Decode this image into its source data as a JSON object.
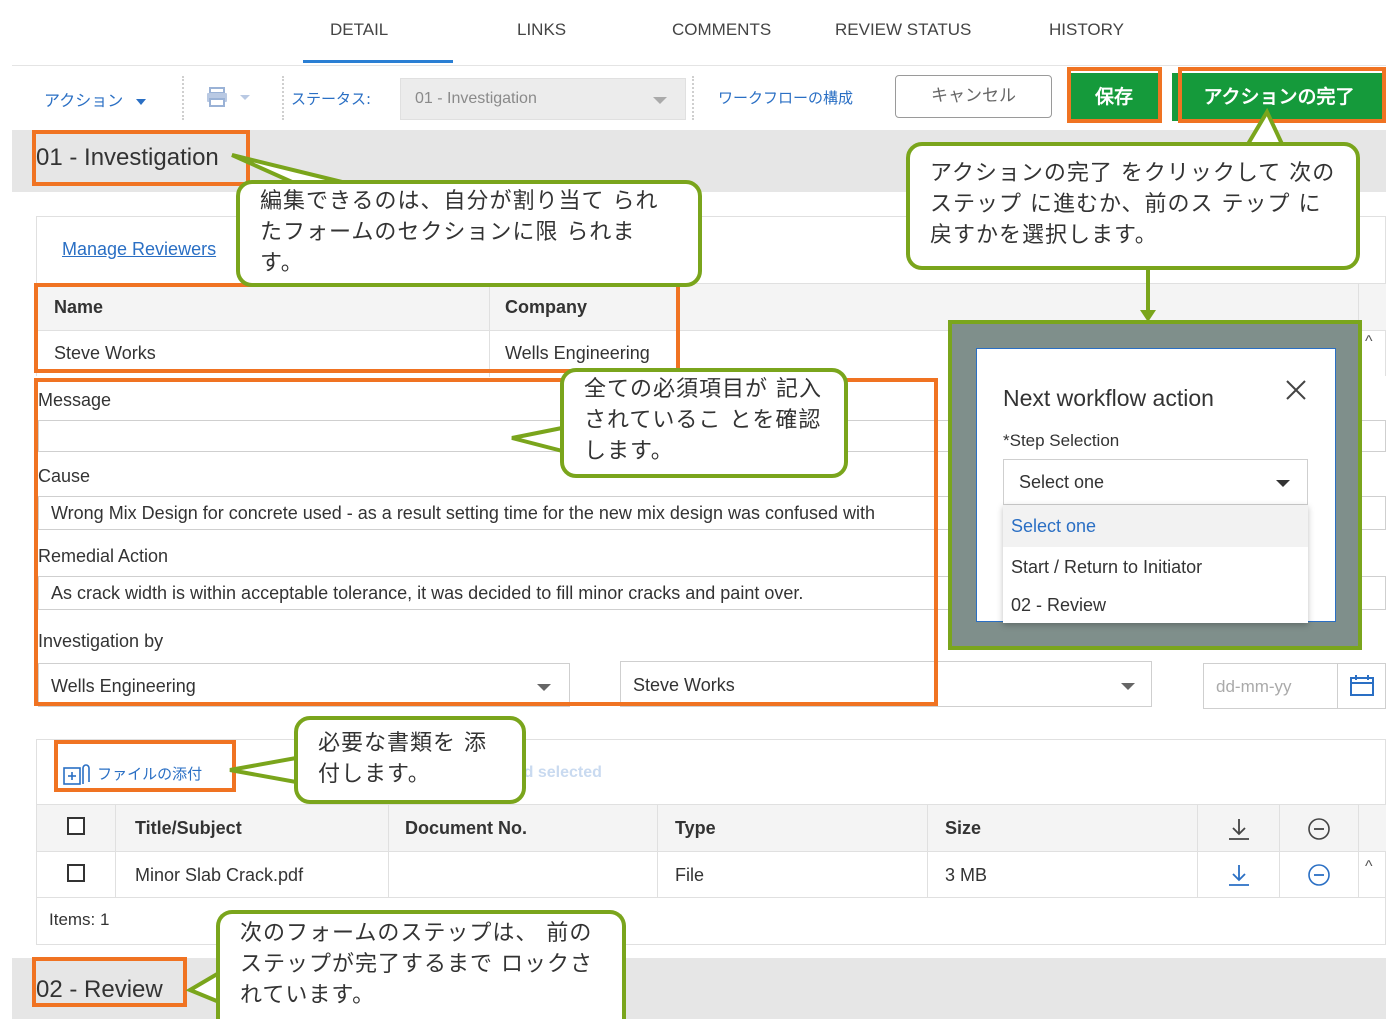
{
  "tabs": [
    "DETAIL",
    "LINKS",
    "COMMENTS",
    "REVIEW STATUS",
    "HISTORY"
  ],
  "toolbar": {
    "action_label": "アクション",
    "status_label": "ステータス:",
    "status_value": "01 - Investigation",
    "workflow_config": "ワークフローの構成",
    "cancel": "キャンセル",
    "save": "保存",
    "complete_action": "アクションの完了"
  },
  "section1": {
    "title": "01 - Investigation",
    "manage_reviewers": "Manage Reviewers",
    "reviewers_table": {
      "headers": [
        "Name",
        "Company"
      ],
      "rows": [
        [
          "Steve Works",
          "Wells Engineering"
        ]
      ]
    },
    "fields": {
      "message_label": "Message",
      "message_value": "",
      "cause_label": "Cause",
      "cause_value": "Wrong Mix Design for concrete used - as a result setting time for the new mix design was confused with",
      "remedial_label": "Remedial Action",
      "remedial_value": "As crack width is within acceptable tolerance, it was decided to fill minor cracks and paint over.",
      "investigation_label": "Investigation by",
      "investigation_company": "Wells Engineering",
      "investigation_person": "Steve Works",
      "date_placeholder": "dd-mm-yy"
    }
  },
  "attachments": {
    "attach_label": "ファイルの添付",
    "download_selected": "Download selected",
    "headers": [
      "Title/Subject",
      "Document No.",
      "Type",
      "Size"
    ],
    "rows": [
      {
        "title": "Minor Slab Crack.pdf",
        "doc_no": "",
        "type": "File",
        "size": "3 MB"
      }
    ],
    "items_count": "Items: 1"
  },
  "section2": {
    "title": "02 - Review"
  },
  "modal": {
    "title": "Next workflow action",
    "step_label": "*Step Selection",
    "select_value": "Select one",
    "options": [
      "Select one",
      "Start / Return to Initiator",
      "02 - Review"
    ]
  },
  "callouts": {
    "edit_sections": "編集できるのは、自分が割り当て られたフォームのセクションに限 られます。",
    "complete_action": "アクションの完了 をクリックして 次のステップ に進むか、前のス テップ に戻すかを選択します。",
    "required_fields": "全ての必須項目が 記入されているこ とを確認します。",
    "attach_docs": "必要な書類を 添付します。",
    "next_step_locked": "次のフォームのステップは、 前のステップが完了するまで ロックされています。"
  },
  "colors": {
    "accent_blue": "#2a6fc4",
    "save_green": "#159a3b",
    "highlight_orange": "#f07322",
    "callout_green": "#7aa51c",
    "modal_overlay": "#7f8f8b"
  }
}
